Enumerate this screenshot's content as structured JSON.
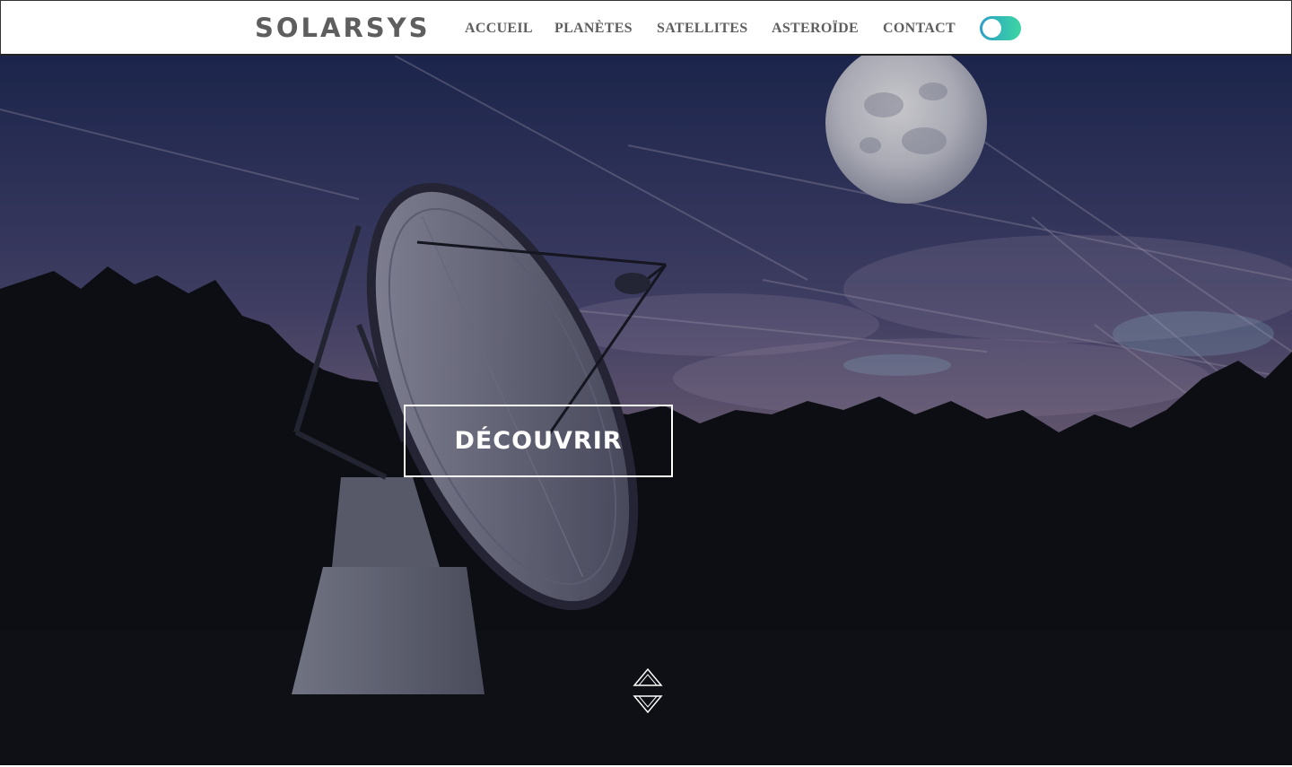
{
  "header": {
    "logo": "SOLARSYS",
    "nav": [
      {
        "label": "ACCUEIL"
      },
      {
        "label": "PLANÈTES"
      },
      {
        "label": "SATELLITES"
      },
      {
        "label": "ASTEROÏDE"
      },
      {
        "label": "CONTACT"
      }
    ],
    "theme_toggle": {
      "state": "off",
      "colors": [
        "#2b9fc9",
        "#3dd6a0"
      ]
    }
  },
  "hero": {
    "cta_label": "DÉCOUVRIR",
    "scroll_icons": [
      "chevron-up-icon",
      "chevron-down-icon"
    ]
  }
}
